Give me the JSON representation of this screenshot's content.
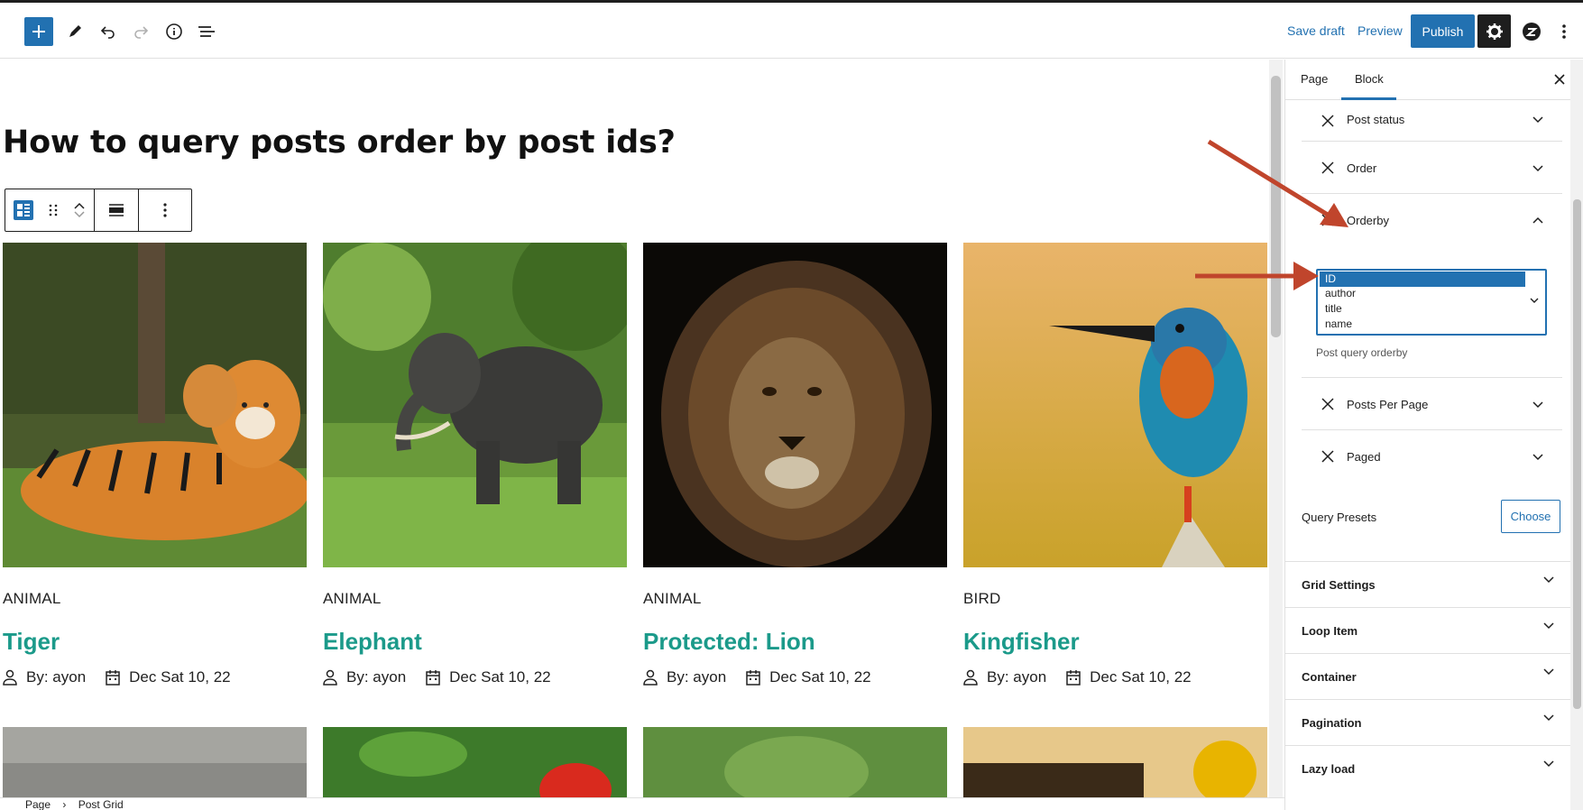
{
  "toolbar": {
    "save_draft": "Save draft",
    "preview": "Preview",
    "publish": "Publish",
    "accent": "#2271b1"
  },
  "page": {
    "title": "How to query posts order by post ids?"
  },
  "posts": [
    {
      "category": "ANIMAL",
      "title": "Tiger",
      "author": "By: ayon",
      "date": "Dec Sat 10, 22"
    },
    {
      "category": "ANIMAL",
      "title": "Elephant",
      "author": "By: ayon",
      "date": "Dec Sat 10, 22"
    },
    {
      "category": "ANIMAL",
      "title": "Protected: Lion",
      "author": "By: ayon",
      "date": "Dec Sat 10, 22"
    },
    {
      "category": "BIRD",
      "title": "Kingfisher",
      "author": "By: ayon",
      "date": "Dec Sat 10, 22"
    }
  ],
  "title_color": "#1b9a8a",
  "breadcrumb": {
    "root": "Page",
    "separator": "›",
    "current": "Post Grid"
  },
  "sidebar": {
    "tabs": [
      "Page",
      "Block"
    ],
    "active_tab": "Block",
    "query_tools": [
      {
        "label": "Post status"
      },
      {
        "label": "Order"
      },
      {
        "label": "Orderby"
      },
      {
        "label": "Posts Per Page"
      },
      {
        "label": "Paged"
      }
    ],
    "orderby_options": [
      "ID",
      "author",
      "title",
      "name"
    ],
    "orderby_selected": "ID",
    "orderby_help": "Post query orderby",
    "query_presets_label": "Query Presets",
    "choose_label": "Choose",
    "panels": [
      "Grid Settings",
      "Loop Item",
      "Container",
      "Pagination",
      "Lazy load"
    ]
  }
}
